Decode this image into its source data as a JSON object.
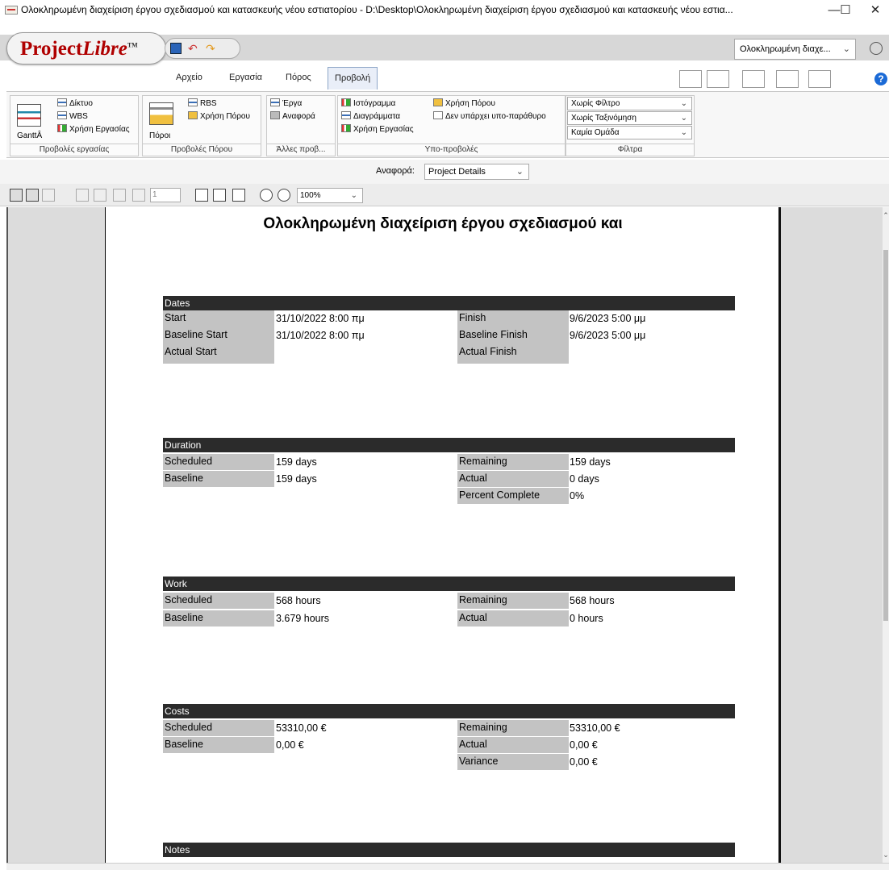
{
  "window": {
    "title": "Ολοκληρωμένη διαχείριση έργου σχεδιασμού και κατασκευής νέου εστιατορίου - D:\\Desktop\\Ολοκληρωμένη διαχείριση έργου σχεδιασμού και κατασκευής νέου εστια...",
    "minimize": "—",
    "maximize": "☐",
    "close": "✕"
  },
  "logo": {
    "main": "Project",
    "italic": "Libre",
    "tm": "TM"
  },
  "menu_tabs": [
    "Αρχείο",
    "Εργασία",
    "Πόρος",
    "Προβολή"
  ],
  "project_selector": "Ολοκληρωμένη διαχε...",
  "ribbon": {
    "task_views": {
      "big": "GanttÂ",
      "items": [
        "Δίκτυο",
        "WBS",
        "Χρήση Εργασίας"
      ],
      "label": "Προβολές εργασίας"
    },
    "resource_views": {
      "big": "Πόροι",
      "items": [
        "RBS",
        "Χρήση Πόρου"
      ],
      "label": "Προβολές Πόρου"
    },
    "other_views": {
      "items": [
        "Έργα",
        "Αναφορά"
      ],
      "label": "Άλλες προβ..."
    },
    "sub_views": {
      "col1": [
        "Ιστόγραμμα",
        "Διαγράμματα",
        "Χρήση Εργασίας"
      ],
      "col2": [
        "Χρήση Πόρου",
        "Δεν υπάρχει υπο-παράθυρο"
      ],
      "label": "Υπο-προβολές"
    },
    "filters": {
      "items": [
        "Χωρίς Φίλτρο",
        "Χωρίς Ταξινόμηση",
        "Καμία Ομάδα"
      ],
      "label": "Φίλτρα"
    }
  },
  "report_selector": {
    "label": "Αναφορά:",
    "value": "Project Details"
  },
  "toolbar": {
    "page": "1",
    "zoom": "100%"
  },
  "report": {
    "title": "Ολοκληρωμένη διαχείριση έργου σχεδιασμού και",
    "dates": {
      "header": "Dates",
      "left": [
        [
          "Start",
          "31/10/2022 8:00 πμ"
        ],
        [
          "Baseline Start",
          "31/10/2022 8:00 πμ"
        ],
        [
          "Actual Start",
          ""
        ]
      ],
      "right": [
        [
          "Finish",
          "9/6/2023 5:00 μμ"
        ],
        [
          "Baseline Finish",
          "9/6/2023 5:00 μμ"
        ],
        [
          "Actual Finish",
          ""
        ]
      ]
    },
    "duration": {
      "header": "Duration",
      "left": [
        [
          "Scheduled",
          "159 days"
        ],
        [
          "Baseline",
          "159 days"
        ]
      ],
      "right": [
        [
          "Remaining",
          "159 days"
        ],
        [
          "Actual",
          "0 days"
        ],
        [
          "Percent Complete",
          "0%"
        ]
      ]
    },
    "work": {
      "header": "Work",
      "left": [
        [
          "Scheduled",
          "568 hours"
        ],
        [
          "Baseline",
          "3.679 hours"
        ]
      ],
      "right": [
        [
          "Remaining",
          "568 hours"
        ],
        [
          "Actual",
          "0 hours"
        ]
      ]
    },
    "costs": {
      "header": "Costs",
      "left": [
        [
          "Scheduled",
          "53310,00 €"
        ],
        [
          "Baseline",
          "0,00 €"
        ]
      ],
      "right": [
        [
          "Remaining",
          "53310,00 €"
        ],
        [
          "Actual",
          "0,00 €"
        ],
        [
          "Variance",
          "0,00 €"
        ]
      ]
    },
    "notes": {
      "header": "Notes"
    }
  }
}
